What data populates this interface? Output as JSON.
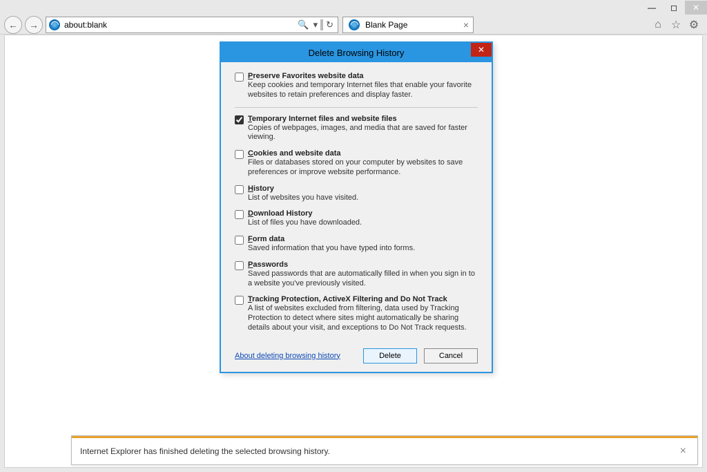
{
  "window": {
    "minimize": "—",
    "maximize": "◻",
    "close": "✕"
  },
  "toolbar": {
    "back": "←",
    "forward": "→",
    "address": "about:blank",
    "search_icon": "🔍",
    "dropdown": "▾",
    "refresh": "↻",
    "tab_label": "Blank Page",
    "tab_close": "×",
    "home": "⌂",
    "fav": "☆",
    "gear": "⚙"
  },
  "dialog": {
    "title": "Delete Browsing History",
    "close": "✕",
    "options": [
      {
        "checked": false,
        "title_pre": "P",
        "title_rest": "reserve Favorites website data",
        "desc": "Keep cookies and temporary Internet files that enable your favorite websites to retain preferences and display faster."
      },
      {
        "checked": true,
        "title_pre": "T",
        "title_rest": "emporary Internet files and website files",
        "desc": "Copies of webpages, images, and media that are saved for faster viewing."
      },
      {
        "checked": false,
        "title_pre": "C",
        "title_rest": "ookies and website data",
        "desc": "Files or databases stored on your computer by websites to save preferences or improve website performance."
      },
      {
        "checked": false,
        "title_pre": "H",
        "title_rest": "istory",
        "desc": "List of websites you have visited."
      },
      {
        "checked": false,
        "title_pre": "D",
        "title_rest": "ownload History",
        "desc": "List of files you have downloaded."
      },
      {
        "checked": false,
        "title_pre": "F",
        "title_rest": "orm data",
        "desc": "Saved information that you have typed into forms."
      },
      {
        "checked": false,
        "title_pre": "P",
        "title_rest": "asswords",
        "desc": "Saved passwords that are automatically filled in when you sign in to a website you've previously visited."
      },
      {
        "checked": false,
        "title_pre": "T",
        "title_rest": "racking Protection, ActiveX Filtering and Do Not Track",
        "desc": "A list of websites excluded from filtering, data used by Tracking Protection to detect where sites might automatically be sharing details about your visit, and exceptions to Do Not Track requests."
      }
    ],
    "link": "About deleting browsing history",
    "delete": "Delete",
    "cancel": "Cancel"
  },
  "notification": {
    "message": "Internet Explorer has finished deleting the selected browsing history.",
    "close": "×"
  }
}
